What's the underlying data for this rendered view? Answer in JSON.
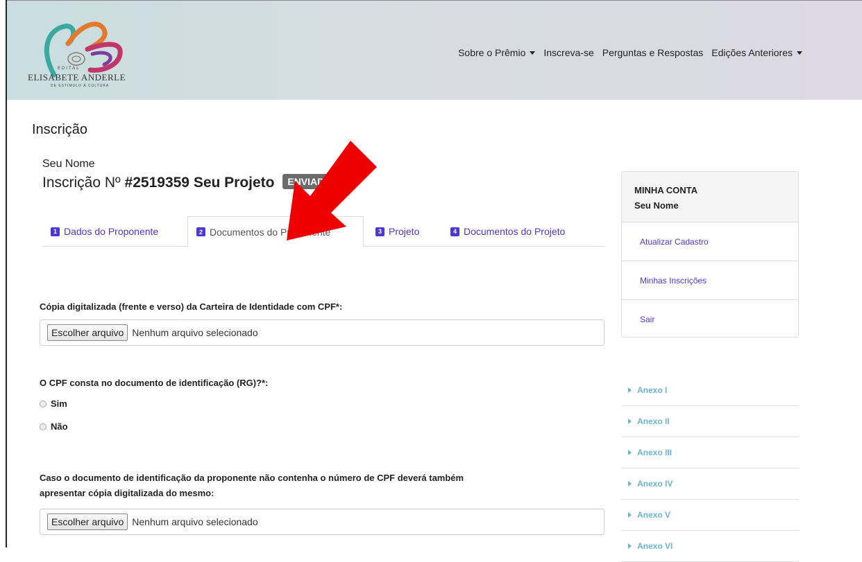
{
  "logo": {
    "small": "EDITAL",
    "name": "ELISABETE ANDERLE",
    "sub": "DE ESTÍMULO À CULTURA"
  },
  "nav": {
    "items": [
      {
        "label": "Sobre o Prêmio",
        "dropdown": true
      },
      {
        "label": "Inscreva-se",
        "dropdown": false
      },
      {
        "label": "Perguntas e Respostas",
        "dropdown": false
      },
      {
        "label": "Edições Anteriores",
        "dropdown": true
      }
    ]
  },
  "page": {
    "title": "Inscrição",
    "user_name": "Seu Nome",
    "insc_prefix": "Inscrição Nº ",
    "insc_number": "#2519359 Seu Projeto",
    "status": "ENVIADO"
  },
  "tabs": [
    {
      "num": "1",
      "label": "Dados do Proponente",
      "active": false
    },
    {
      "num": "2",
      "label": "Documentos do Proponente",
      "active": true
    },
    {
      "num": "3",
      "label": "Projeto",
      "active": false
    },
    {
      "num": "4",
      "label": "Documentos do Projeto",
      "active": false
    }
  ],
  "form": {
    "field1_label": "Cópia digitalizada (frente e verso) da Carteira de Identidade com CPF*:",
    "file_button": "Escolher arquivo",
    "file_status": "Nenhum arquivo selecionado",
    "question": "O CPF consta no documento de identificação (RG)?*:",
    "opt_yes": "Sim",
    "opt_no": "Não",
    "field2_line1": "Caso o documento de identificação da proponente não contenha o número de CPF deverá também",
    "field2_line2": "apresentar cópia digitalizada do mesmo:"
  },
  "account": {
    "heading": "MINHA CONTA",
    "name": "Seu Nome",
    "items": [
      "Atualizar Cadastro",
      "Minhas Inscrições",
      "Sair"
    ]
  },
  "annexes": [
    "Anexo I",
    "Anexo II",
    "Anexo III",
    "Anexo IV",
    "Anexo V",
    "Anexo VI"
  ],
  "colors": {
    "link": "#4c36d6",
    "annex": "#6bb3d6",
    "arrow": "#ee0000",
    "badge": "#6b6b6b"
  }
}
